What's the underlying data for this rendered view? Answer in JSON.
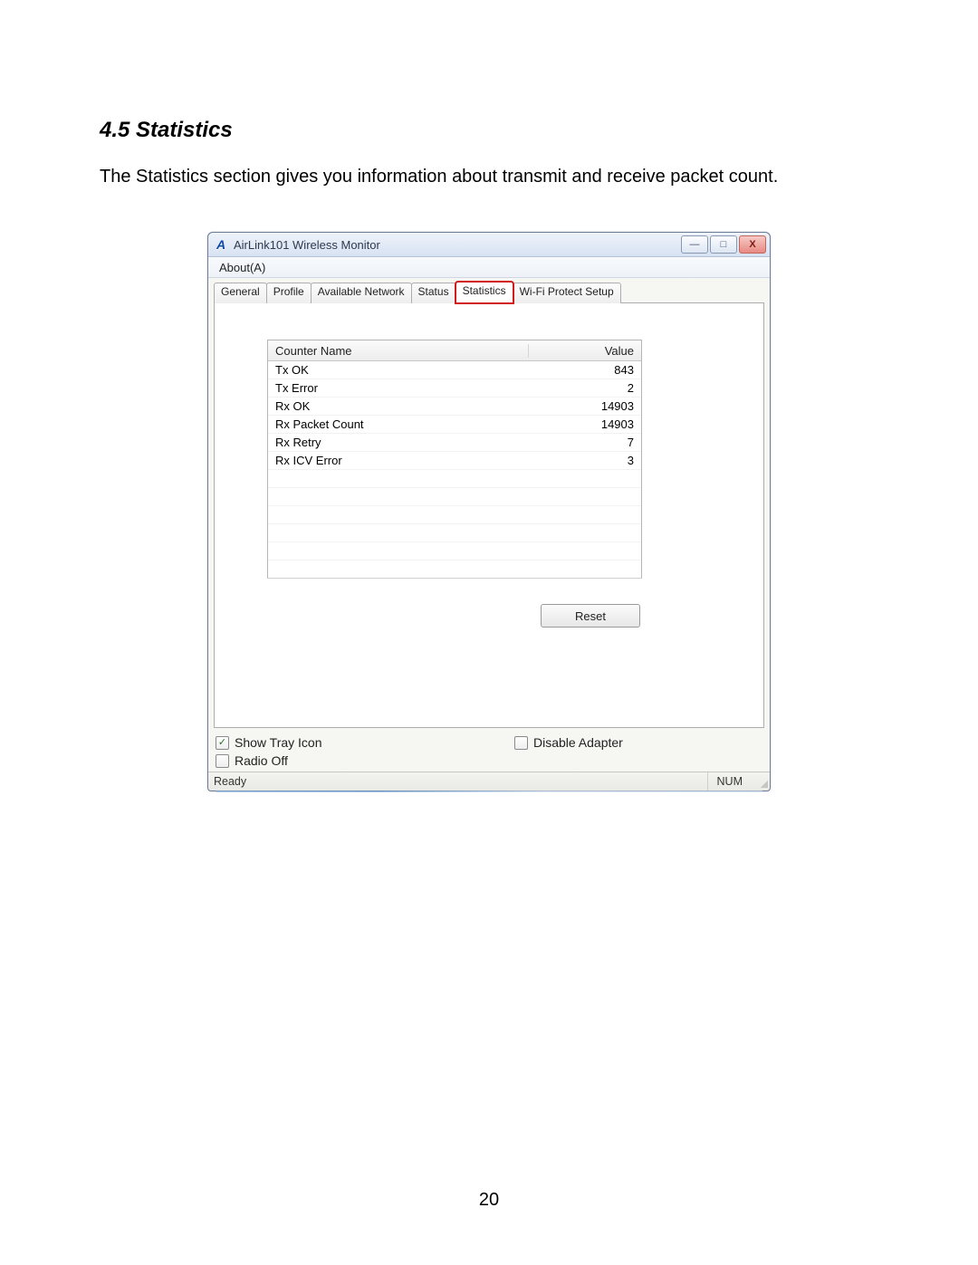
{
  "doc": {
    "heading": "4.5 Statistics",
    "paragraph": "The Statistics section gives you information about transmit and receive packet count.",
    "page_number": "20"
  },
  "window": {
    "title": "AirLink101 Wireless Monitor",
    "app_icon_text": "A",
    "controls": {
      "minimize_glyph": "—",
      "maximize_glyph": "□",
      "close_glyph": "X"
    },
    "menubar": {
      "items": [
        "About(A)"
      ]
    },
    "tabs": {
      "items": [
        "General",
        "Profile",
        "Available Network",
        "Status",
        "Statistics",
        "Wi-Fi Protect Setup"
      ],
      "active_index": 4,
      "highlight_index": 4
    },
    "statistics": {
      "columns": {
        "name": "Counter Name",
        "value": "Value"
      },
      "rows": [
        {
          "name": "Tx OK",
          "value": "843"
        },
        {
          "name": "Tx Error",
          "value": "2"
        },
        {
          "name": "Rx OK",
          "value": "14903"
        },
        {
          "name": "Rx Packet Count",
          "value": "14903"
        },
        {
          "name": "Rx Retry",
          "value": "7"
        },
        {
          "name": "Rx ICV Error",
          "value": "3"
        }
      ],
      "empty_row_count": 6,
      "reset_label": "Reset"
    },
    "checkboxes": {
      "show_tray_icon": {
        "label": "Show Tray Icon",
        "checked": true
      },
      "disable_adapter": {
        "label": "Disable Adapter",
        "checked": false
      },
      "radio_off": {
        "label": "Radio Off",
        "checked": false
      }
    },
    "statusbar": {
      "left": "Ready",
      "indicator": "NUM"
    }
  }
}
